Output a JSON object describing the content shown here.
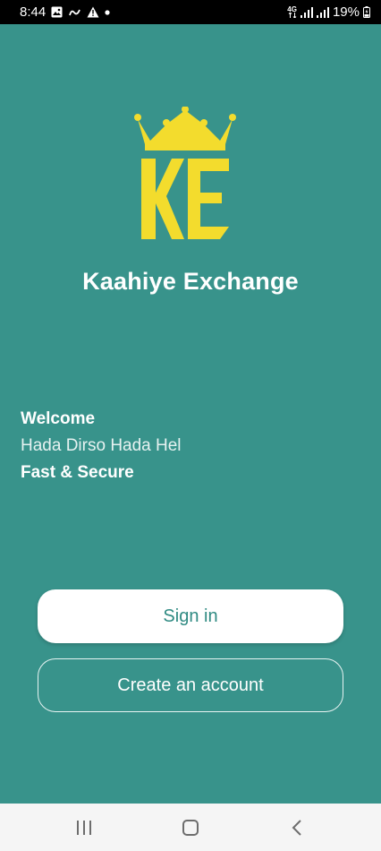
{
  "status_bar": {
    "time": "8:44",
    "network_label": "4G",
    "battery_percent": "19%",
    "left_icons": [
      "gallery-icon",
      "link-icon",
      "warning-icon",
      "dot-icon"
    ],
    "right_icons": [
      "data-arrows-icon",
      "signal-icon",
      "signal-icon",
      "battery-charging-icon"
    ]
  },
  "app": {
    "logo_icon": "ke-crown-logo",
    "brand_name": "Kaahiye Exchange",
    "welcome_title": "Welcome",
    "tagline": "Hada Dirso Hada Hel",
    "subtitle": "Fast & Secure"
  },
  "buttons": {
    "sign_in": "Sign in",
    "create_account": "Create an account"
  },
  "nav_bar": {
    "items": [
      "recents-icon",
      "home-icon",
      "back-icon"
    ]
  },
  "colors": {
    "background": "#38938b",
    "logo_yellow": "#f3dc2d",
    "sign_in_text": "#2f8a82"
  }
}
